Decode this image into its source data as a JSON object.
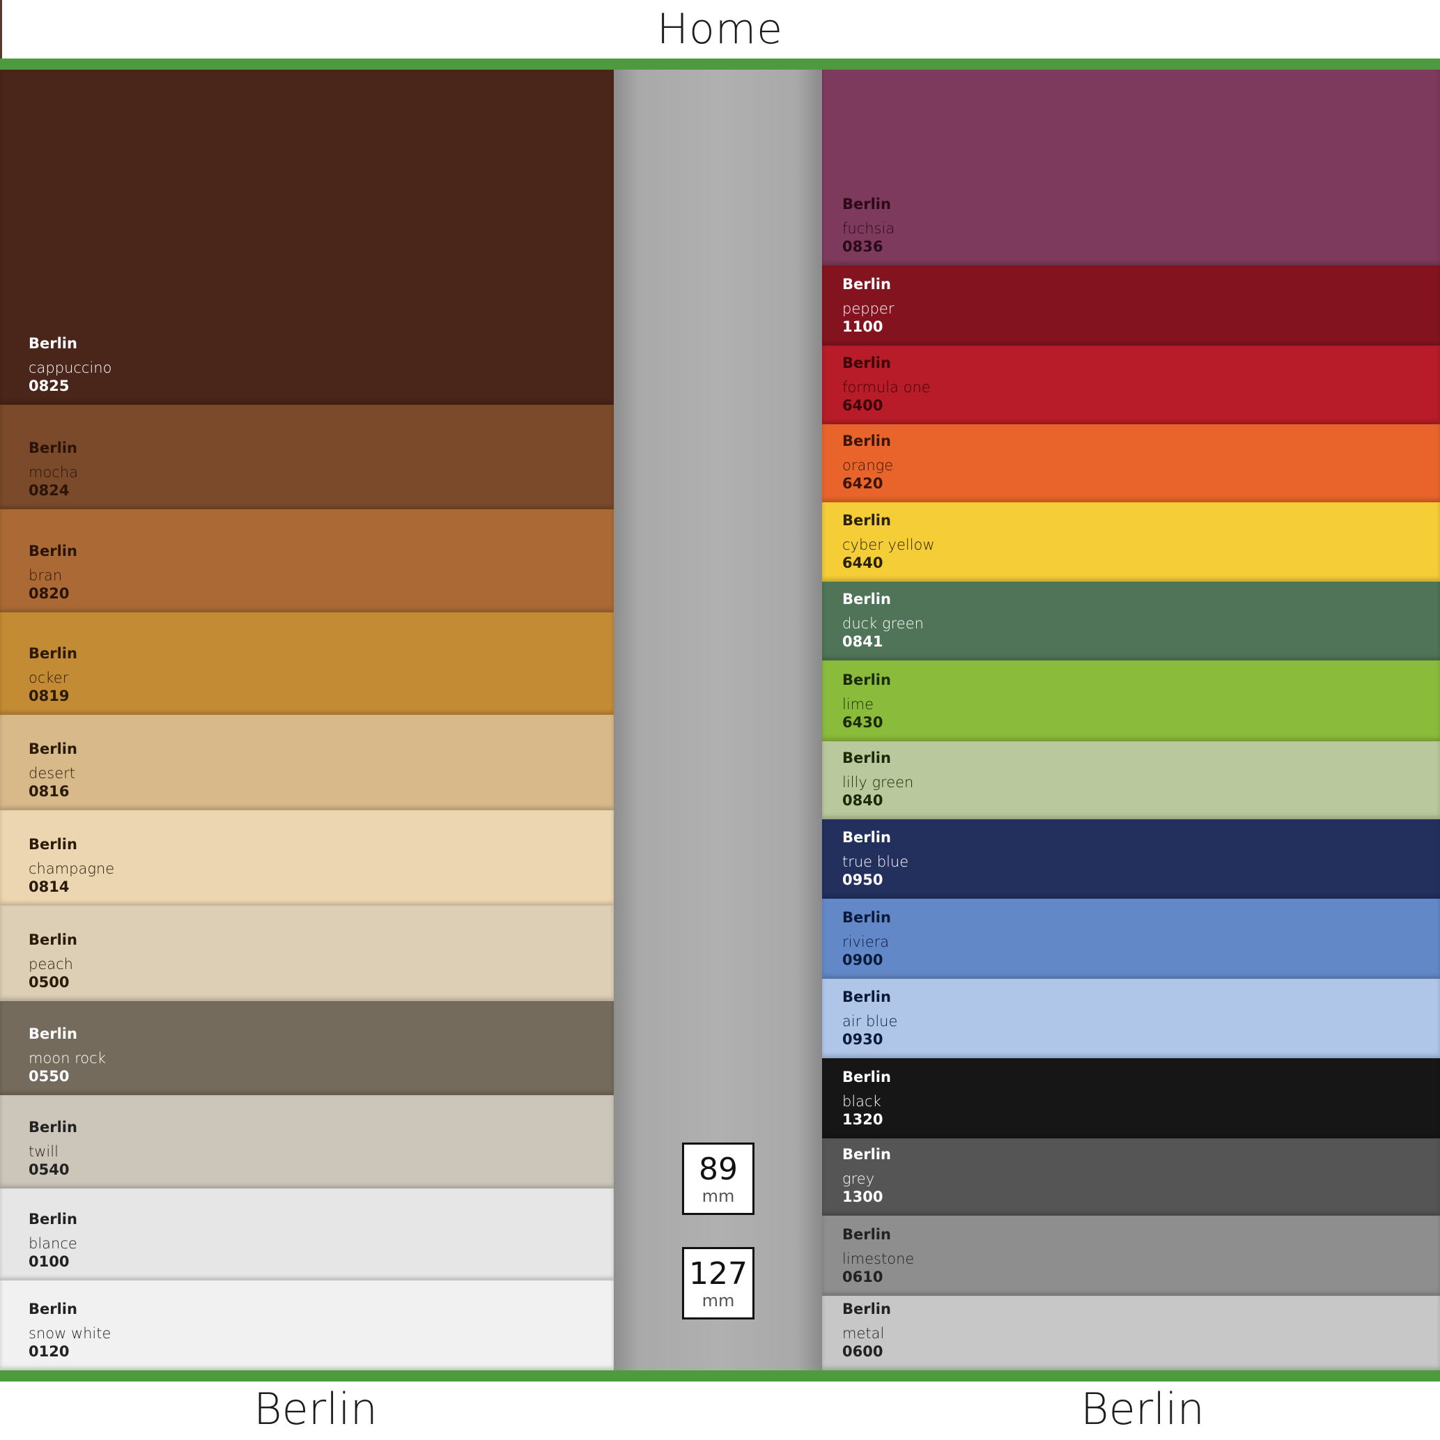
{
  "header": {
    "title": "Home"
  },
  "footer": {
    "left_label": "Berlin",
    "right_label": "Berlin"
  },
  "sizes": [
    {
      "value": "89",
      "unit": "mm"
    },
    {
      "value": "127",
      "unit": "mm"
    }
  ],
  "left_swatches": [
    {
      "brand": "Berlin",
      "name": "cappuccino",
      "code": "0825",
      "color": "#4a2519",
      "text": "#ffffff"
    },
    {
      "brand": "Berlin",
      "name": "mocha",
      "code": "0824",
      "color": "#7a4a2a",
      "text": "#2a1408"
    },
    {
      "brand": "Berlin",
      "name": "bran",
      "code": "0820",
      "color": "#ab6a35",
      "text": "#2a1408"
    },
    {
      "brand": "Berlin",
      "name": "ocker",
      "code": "0819",
      "color": "#c48b35",
      "text": "#2a1a08"
    },
    {
      "brand": "Berlin",
      "name": "desert",
      "code": "0816",
      "color": "#d8b98a",
      "text": "#2a1a08"
    },
    {
      "brand": "Berlin",
      "name": "champagne",
      "code": "0814",
      "color": "#ecd6b1",
      "text": "#2a1a08"
    },
    {
      "brand": "Berlin",
      "name": "peach",
      "code": "0500",
      "color": "#dccfb6",
      "text": "#2a1a08"
    },
    {
      "brand": "Berlin",
      "name": "moon rock",
      "code": "0550",
      "color": "#746b5c",
      "text": "#ffffff"
    },
    {
      "brand": "Berlin",
      "name": "twill",
      "code": "0540",
      "color": "#cbc5ba",
      "text": "#222222"
    },
    {
      "brand": "Berlin",
      "name": "blance",
      "code": "0100",
      "color": "#e6e6e6",
      "text": "#222222"
    },
    {
      "brand": "Berlin",
      "name": "snow white",
      "code": "0120",
      "color": "#f1f1f1",
      "text": "#222222"
    }
  ],
  "right_swatches": [
    {
      "brand": "Berlin",
      "name": "fuchsia",
      "code": "0836",
      "color": "#7e3a5c",
      "text": "#2a0a18"
    },
    {
      "brand": "Berlin",
      "name": "pepper",
      "code": "1100",
      "color": "#83141f",
      "text": "#ffffff"
    },
    {
      "brand": "Berlin",
      "name": "formula one",
      "code": "6400",
      "color": "#b71c28",
      "text": "#3a0408"
    },
    {
      "brand": "Berlin",
      "name": "orange",
      "code": "6420",
      "color": "#e8642a",
      "text": "#3a1404"
    },
    {
      "brand": "Berlin",
      "name": "cyber yellow",
      "code": "6440",
      "color": "#f5cd36",
      "text": "#2a2004"
    },
    {
      "brand": "Berlin",
      "name": "duck green",
      "code": "0841",
      "color": "#4f7458",
      "text": "#ffffff"
    },
    {
      "brand": "Berlin",
      "name": "lime",
      "code": "6430",
      "color": "#8bbb3a",
      "text": "#1a2a04"
    },
    {
      "brand": "Berlin",
      "name": "lilly green",
      "code": "0840",
      "color": "#b9c89d",
      "text": "#1a2a04"
    },
    {
      "brand": "Berlin",
      "name": "true blue",
      "code": "0950",
      "color": "#23305e",
      "text": "#ffffff"
    },
    {
      "brand": "Berlin",
      "name": "riviera",
      "code": "0900",
      "color": "#6388c8",
      "text": "#0a1a3a"
    },
    {
      "brand": "Berlin",
      "name": "air blue",
      "code": "0930",
      "color": "#afc6e8",
      "text": "#0a1a3a"
    },
    {
      "brand": "Berlin",
      "name": "black",
      "code": "1320",
      "color": "#161616",
      "text": "#ffffff"
    },
    {
      "brand": "Berlin",
      "name": "grey",
      "code": "1300",
      "color": "#555555",
      "text": "#ffffff"
    },
    {
      "brand": "Berlin",
      "name": "limestone",
      "code": "0610",
      "color": "#8e8e8e",
      "text": "#222222"
    },
    {
      "brand": "Berlin",
      "name": "metal",
      "code": "0600",
      "color": "#c7c7c7",
      "text": "#222222"
    }
  ]
}
